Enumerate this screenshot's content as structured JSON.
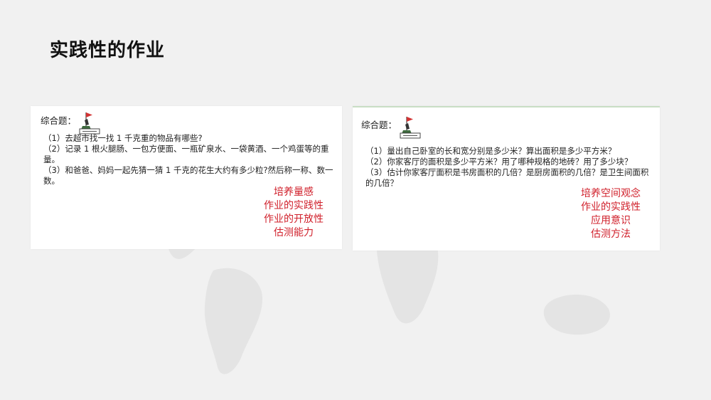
{
  "slide": {
    "title": "实践性的作业"
  },
  "cards": [
    {
      "heading": "综合题：",
      "badge_icon": "flag-badge-icon",
      "items": [
        "（1）去超市找一找 1 千克重的物品有哪些?",
        "（2）记录 1 根火腿肠、一包方便面、一瓶矿泉水、一袋黄酒、一个鸡蛋等的重量。",
        "（3）和爸爸、妈妈一起先猜一猜 1 千克的花生大约有多少粒?然后称一称、数一数。"
      ],
      "goals": [
        "培养量感",
        "作业的实践性",
        "作业的开放性",
        "估测能力"
      ]
    },
    {
      "heading": "综合题：",
      "badge_icon": "flag-badge-icon",
      "items": [
        "（1）量出自己卧室的长和宽分别是多少米？算出面积是多少平方米？",
        "（2）你家客厅的面积是多少平方米？用了哪种规格的地砖？用了多少块？",
        "（3）估计你家客厅面积是书房面积的几倍？是厨房面积的几倍？是卫生间面积的几倍？"
      ],
      "goals": [
        "培养空间观念",
        "作业的实践性",
        "应用意识",
        "估测方法"
      ]
    }
  ],
  "colors": {
    "goal_text": "#d0202b",
    "background": "#f1f1f1",
    "map": "#e4e4e4"
  }
}
